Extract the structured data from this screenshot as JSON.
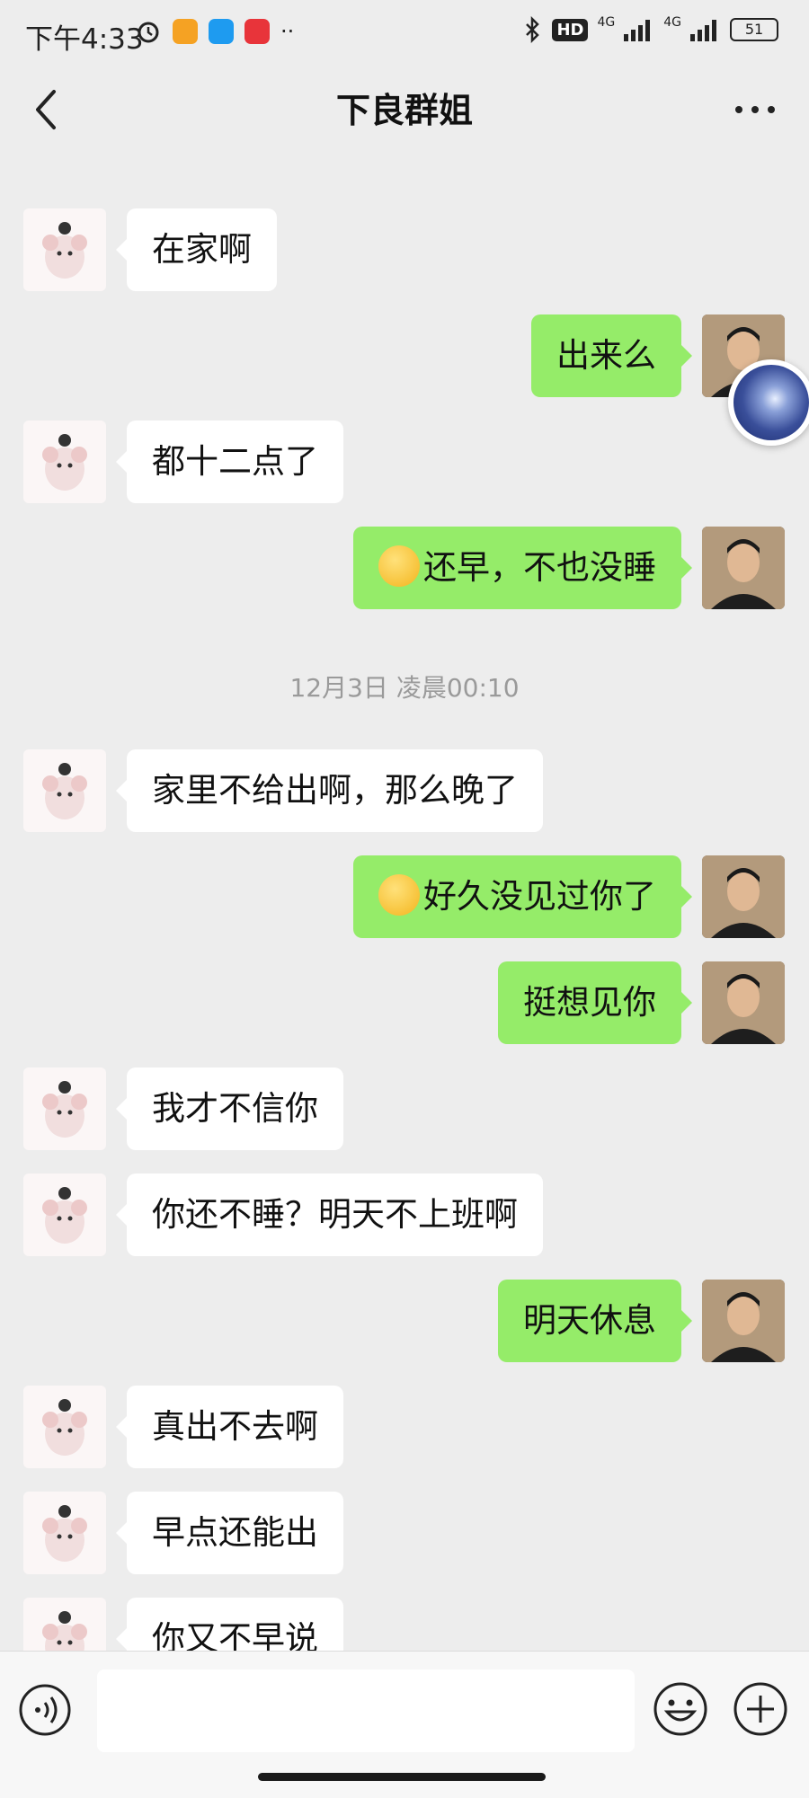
{
  "status_bar": {
    "time": "下午4:33",
    "network": "4G",
    "hd_badge": "HD",
    "battery": "51"
  },
  "header": {
    "title": "下良群姐"
  },
  "messages": [
    {
      "side": "left",
      "text": "在家啊"
    },
    {
      "side": "right",
      "text": "出来么"
    },
    {
      "side": "left",
      "text": "都十二点了"
    },
    {
      "side": "right",
      "emoji": true,
      "text": "还早，不也没睡"
    },
    {
      "type": "timestamp",
      "text": "12月3日 凌晨00:10"
    },
    {
      "side": "left",
      "text": "家里不给出啊，那么晚了"
    },
    {
      "side": "right",
      "emoji": true,
      "text": "好久没见过你了"
    },
    {
      "side": "right",
      "text": "挺想见你"
    },
    {
      "side": "left",
      "text": "我才不信你"
    },
    {
      "side": "left",
      "text": "你还不睡？明天不上班啊"
    },
    {
      "side": "right",
      "text": "明天休息"
    },
    {
      "side": "left",
      "text": "真出不去啊"
    },
    {
      "side": "left",
      "text": "早点还能出"
    },
    {
      "side": "left",
      "text": "你又不早说"
    }
  ],
  "composer": {
    "input_value": "",
    "voice_icon": "voice-icon",
    "emoji_icon": "smiley-icon",
    "plus_icon": "plus-circle-icon"
  },
  "colors": {
    "background": "#ededed",
    "self_bubble": "#95ec69",
    "other_bubble": "#ffffff"
  }
}
